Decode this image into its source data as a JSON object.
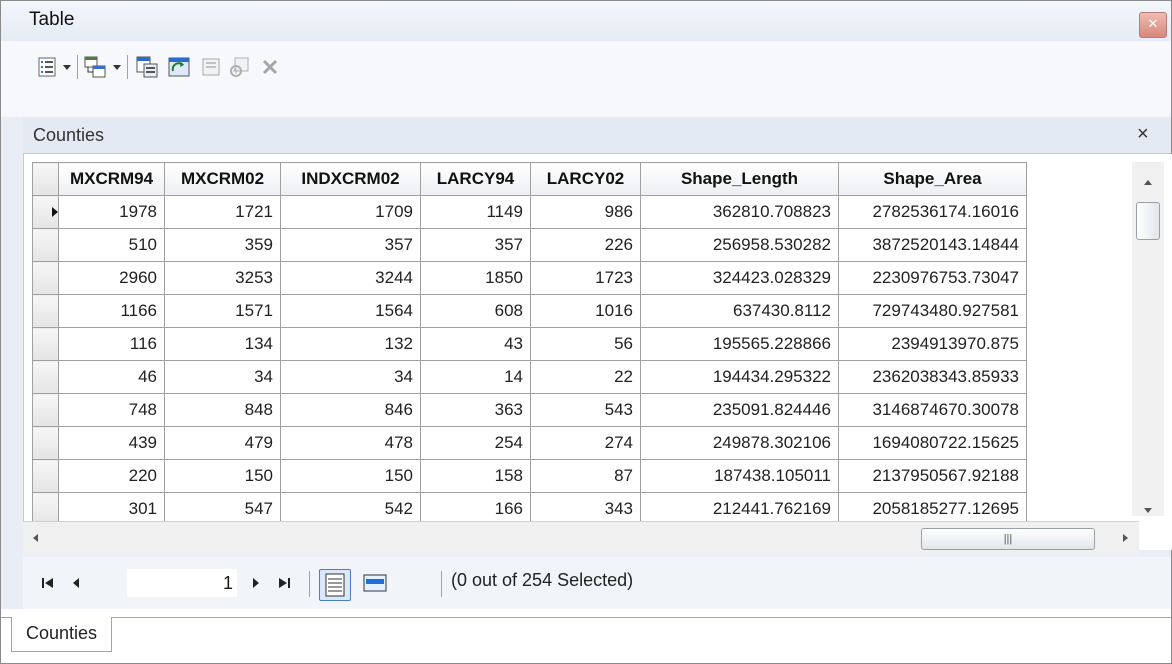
{
  "window": {
    "title": "Table",
    "close_glyph": "✕"
  },
  "toolbar": {
    "icons": [
      "table-options-icon",
      "related-tables-icon",
      "select-by-attributes-icon",
      "switch-selection-icon",
      "clear-selection-icon",
      "zoom-to-selected-icon",
      "delete-selected-icon"
    ]
  },
  "table_tab": {
    "title": "Counties",
    "close_glyph": "×"
  },
  "grid": {
    "columns": [
      "MXCRM94",
      "MXCRM02",
      "INDXCRM02",
      "LARCY94",
      "LARCY02",
      "Shape_Length",
      "Shape_Area"
    ],
    "rows": [
      [
        "1978",
        "1721",
        "1709",
        "1149",
        "986",
        "362810.708823",
        "2782536174.16016"
      ],
      [
        "510",
        "359",
        "357",
        "357",
        "226",
        "256958.530282",
        "3872520143.14844"
      ],
      [
        "2960",
        "3253",
        "3244",
        "1850",
        "1723",
        "324423.028329",
        "2230976753.73047"
      ],
      [
        "1166",
        "1571",
        "1564",
        "608",
        "1016",
        "637430.8112",
        "729743480.927581"
      ],
      [
        "116",
        "134",
        "132",
        "43",
        "56",
        "195565.228866",
        "2394913970.875"
      ],
      [
        "46",
        "34",
        "34",
        "14",
        "22",
        "194434.295322",
        "2362038343.85933"
      ],
      [
        "748",
        "848",
        "846",
        "363",
        "543",
        "235091.824446",
        "3146874670.30078"
      ],
      [
        "439",
        "479",
        "478",
        "254",
        "274",
        "249878.302106",
        "1694080722.15625"
      ],
      [
        "220",
        "150",
        "150",
        "158",
        "87",
        "187438.105011",
        "2137950567.92188"
      ],
      [
        "301",
        "547",
        "542",
        "166",
        "343",
        "212441.762169",
        "2058185277.12695"
      ]
    ],
    "current_row": 0
  },
  "navigation": {
    "first_glyph": "◂◂",
    "prev_glyph": "◂",
    "next_glyph": "▸",
    "last_glyph": "▸▸",
    "record_number": "1",
    "selection_status": "(0 out of 254 Selected)"
  },
  "bottom_tab": {
    "label": "Counties"
  },
  "colors": {
    "accent": "#4a7cc9",
    "grid_border": "#a0a0a0",
    "window_bg": "#e9eef6"
  }
}
